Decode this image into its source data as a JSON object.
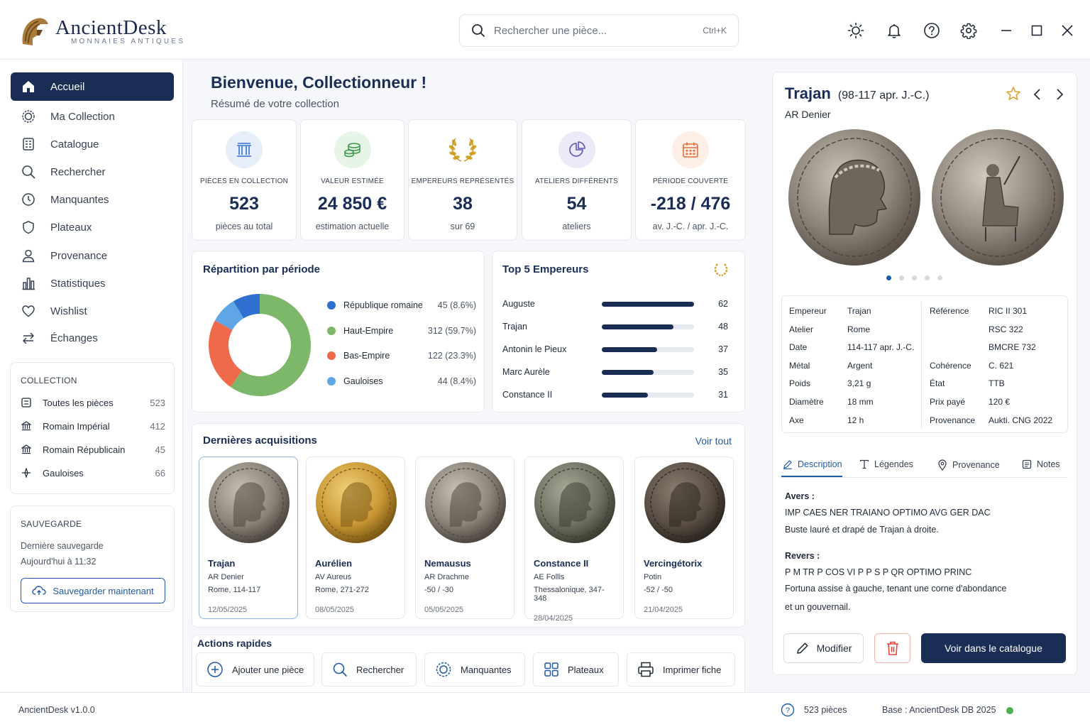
{
  "app": {
    "name": "AncientDesk",
    "subtitle": "MONNAIES ANTIQUES"
  },
  "search": {
    "placeholder": "Rechercher une pièce...",
    "shortcut": "Ctrl+K"
  },
  "toolbar_icons": [
    "sun-icon",
    "bell-icon",
    "help-icon",
    "gear-icon",
    "minimize-icon",
    "maximize-icon",
    "close-icon"
  ],
  "sidebar": {
    "nav": [
      {
        "label": "Accueil",
        "icon": "home-icon",
        "active": true
      },
      {
        "label": "Ma Collection",
        "icon": "coin-icon"
      },
      {
        "label": "Catalogue",
        "icon": "catalog-icon"
      },
      {
        "label": "Rechercher",
        "icon": "search-icon"
      },
      {
        "label": "Manquantes",
        "icon": "clock-icon"
      },
      {
        "label": "Plateaux",
        "icon": "shield-icon"
      },
      {
        "label": "Provenance",
        "icon": "person-icon"
      },
      {
        "label": "Statistiques",
        "icon": "chart-icon"
      },
      {
        "label": "Wishlist",
        "icon": "heart-icon"
      },
      {
        "label": "Échanges",
        "icon": "exchange-icon"
      }
    ],
    "collection": {
      "title": "COLLECTION",
      "items": [
        {
          "label": "Toutes les pièces",
          "count": "523"
        },
        {
          "label": "Romain Impérial",
          "count": "412"
        },
        {
          "label": "Romain Républicain",
          "count": "45"
        },
        {
          "label": "Gauloises",
          "count": "66"
        }
      ]
    },
    "backup": {
      "title": "SAUVEGARDE",
      "last_label": "Dernière sauvegarde",
      "last_value": "Aujourd'hui à 11:32",
      "button": "Sauvegarder maintenant"
    }
  },
  "main": {
    "title": "Bienvenue, Collectionneur !",
    "subtitle": "Résumé de votre collection",
    "stats": [
      {
        "label": "PIÈCES EN COLLECTION",
        "value": "523",
        "sub": "pièces au total"
      },
      {
        "label": "VALEUR ESTIMÉE",
        "value": "24 850 €",
        "sub": "estimation actuelle"
      },
      {
        "label": "EMPEREURS REPRÉSENTÉS",
        "value": "38",
        "sub": "sur 69"
      },
      {
        "label": "ATELIERS DIFFÉRENTS",
        "value": "54",
        "sub": "ateliers"
      },
      {
        "label": "PÉRIODE COUVERTE",
        "value": "-218 / 476",
        "sub": "av. J.-C. / apr. J.-C."
      }
    ],
    "period": {
      "title": "Répartition par période",
      "items": [
        {
          "label": "République romaine",
          "value": "45 (8.6%)",
          "count": 45,
          "color": "#2f6fd0"
        },
        {
          "label": "Haut-Empire",
          "value": "312 (59.7%)",
          "count": 312,
          "color": "#7db86a"
        },
        {
          "label": "Bas-Empire",
          "value": "122 (23.3%)",
          "count": 122,
          "color": "#ee6a4b"
        },
        {
          "label": "Gauloises",
          "value": "44 (8.4%)",
          "count": 44,
          "color": "#5ea6e6"
        }
      ]
    },
    "top5": {
      "title": "Top 5 Empereurs",
      "max": 62,
      "items": [
        {
          "name": "Auguste",
          "count": "62",
          "n": 62
        },
        {
          "name": "Trajan",
          "count": "48",
          "n": 48
        },
        {
          "name": "Antonin le Pieux",
          "count": "37",
          "n": 37
        },
        {
          "name": "Marc Aurèle",
          "count": "35",
          "n": 35
        },
        {
          "name": "Constance II",
          "count": "31",
          "n": 31
        }
      ]
    },
    "acquisitions": {
      "title": "Dernières acquisitions",
      "link": "Voir tout",
      "items": [
        {
          "name": "Trajan",
          "type": "AR Denier",
          "detail": "Rome, 114-117",
          "date": "12/05/2025",
          "metal": "silver"
        },
        {
          "name": "Aurélien",
          "type": "AV Aureus",
          "detail": "Rome, 271-272",
          "date": "08/05/2025",
          "metal": "gold"
        },
        {
          "name": "Nemausus",
          "type": "AR Drachme",
          "detail": "-50 / -30",
          "date": "05/05/2025",
          "metal": "silver"
        },
        {
          "name": "Constance II",
          "type": "AE Follis",
          "detail": "Thessalonique, 347-348",
          "date": "28/04/2025",
          "metal": "bronze"
        },
        {
          "name": "Vercingétorix",
          "type": "Potin",
          "detail": "-52 / -50",
          "date": "21/04/2025",
          "metal": "dark"
        }
      ]
    },
    "quick_actions": {
      "title": "Actions rapides",
      "items": [
        "Ajouter une pièce",
        "Rechercher",
        "Manquantes",
        "Plateaux",
        "Imprimer fiche"
      ]
    }
  },
  "detail": {
    "name": "Trajan",
    "period": "(98-117 apr. J.-C.)",
    "type": "AR Denier",
    "fields_left": [
      {
        "k": "Empereur",
        "v": "Trajan"
      },
      {
        "k": "Atelier",
        "v": "Rome"
      },
      {
        "k": "Date",
        "v": "114-117 apr. J.-C."
      },
      {
        "k": "Métal",
        "v": "Argent"
      },
      {
        "k": "Poids",
        "v": "3,21 g"
      },
      {
        "k": "Diamètre",
        "v": "18 mm"
      },
      {
        "k": "Axe",
        "v": "12 h"
      }
    ],
    "fields_right": [
      {
        "k": "Référence",
        "v": "RIC II 301"
      },
      {
        "k": "",
        "v": "RSC 322"
      },
      {
        "k": "",
        "v": "BMCRE 732"
      },
      {
        "k": "Cohérence",
        "v": "C. 621"
      },
      {
        "k": "État",
        "v": "TTB"
      },
      {
        "k": "Prix payé",
        "v": "120 €"
      },
      {
        "k": "Provenance",
        "v": "Aukti. CNG 2022"
      }
    ],
    "tabs": [
      "Description",
      "Légendes",
      "Provenance",
      "Notes"
    ],
    "obverse_title": "Avers :",
    "obverse_legend": "IMP CAES NER TRAIANO OPTIMO AVG GER DAC",
    "obverse_desc": "Buste lauré et drapé de Trajan à droite.",
    "reverse_title": "Revers :",
    "reverse_legend": "P M TR P COS VI P P S P QR OPTIMO PRINC",
    "reverse_desc_1": "Fortuna assise à gauche, tenant une corne d'abondance",
    "reverse_desc_2": "et un gouvernail.",
    "buttons": {
      "edit": "Modifier",
      "catalog": "Voir dans le catalogue"
    }
  },
  "status": {
    "version": "AncientDesk v1.0.0",
    "count": "523 pièces",
    "db": "Base : AncientDesk DB 2025"
  },
  "colors": {
    "navy": "#1a2e55",
    "accent": "#1f5aa6",
    "online": "#4caf50"
  }
}
